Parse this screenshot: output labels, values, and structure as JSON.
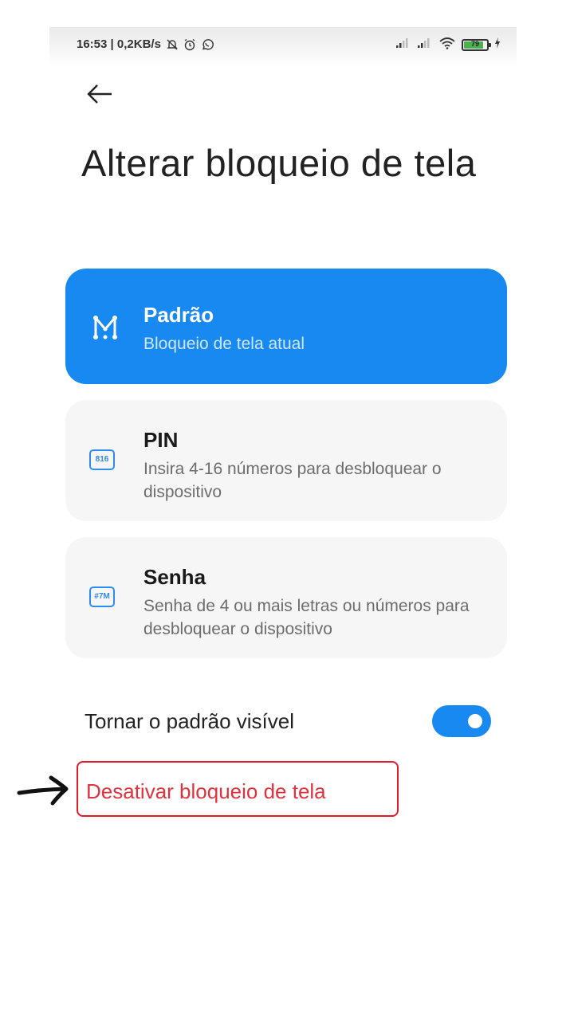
{
  "status_bar": {
    "time_and_speed": "16:53 | 0,2KB/s",
    "battery_level": "79",
    "icons": [
      "mute-icon",
      "alarm-icon",
      "whatsapp-icon",
      "signal-icon",
      "signal-icon",
      "wifi-icon",
      "battery-icon",
      "charging-icon"
    ]
  },
  "header": {
    "back_icon": "back-arrow-icon",
    "title": "Alterar bloqueio de tela"
  },
  "options": [
    {
      "title": "Padrão",
      "description": "Bloqueio de tela atual",
      "icon": "pattern-icon",
      "selected": true
    },
    {
      "title": "PIN",
      "description": "Insira 4-16 números para desbloquear o dispositivo",
      "icon": "pin-icon",
      "icon_text": "816",
      "selected": false
    },
    {
      "title": "Senha",
      "description": "Senha de 4 ou mais letras ou números para desbloquear o dispositivo",
      "icon": "password-icon",
      "icon_text": "#7M",
      "selected": false
    }
  ],
  "settings": {
    "visible_pattern_label": "Tornar o padrão visível",
    "visible_pattern_enabled": true,
    "disable_lock_label": "Desativar bloqueio de tela"
  },
  "colors": {
    "accent": "#1889f0",
    "card_background": "#f6f6f6",
    "danger": "#e0323d",
    "highlight_border": "#e11b2b"
  }
}
